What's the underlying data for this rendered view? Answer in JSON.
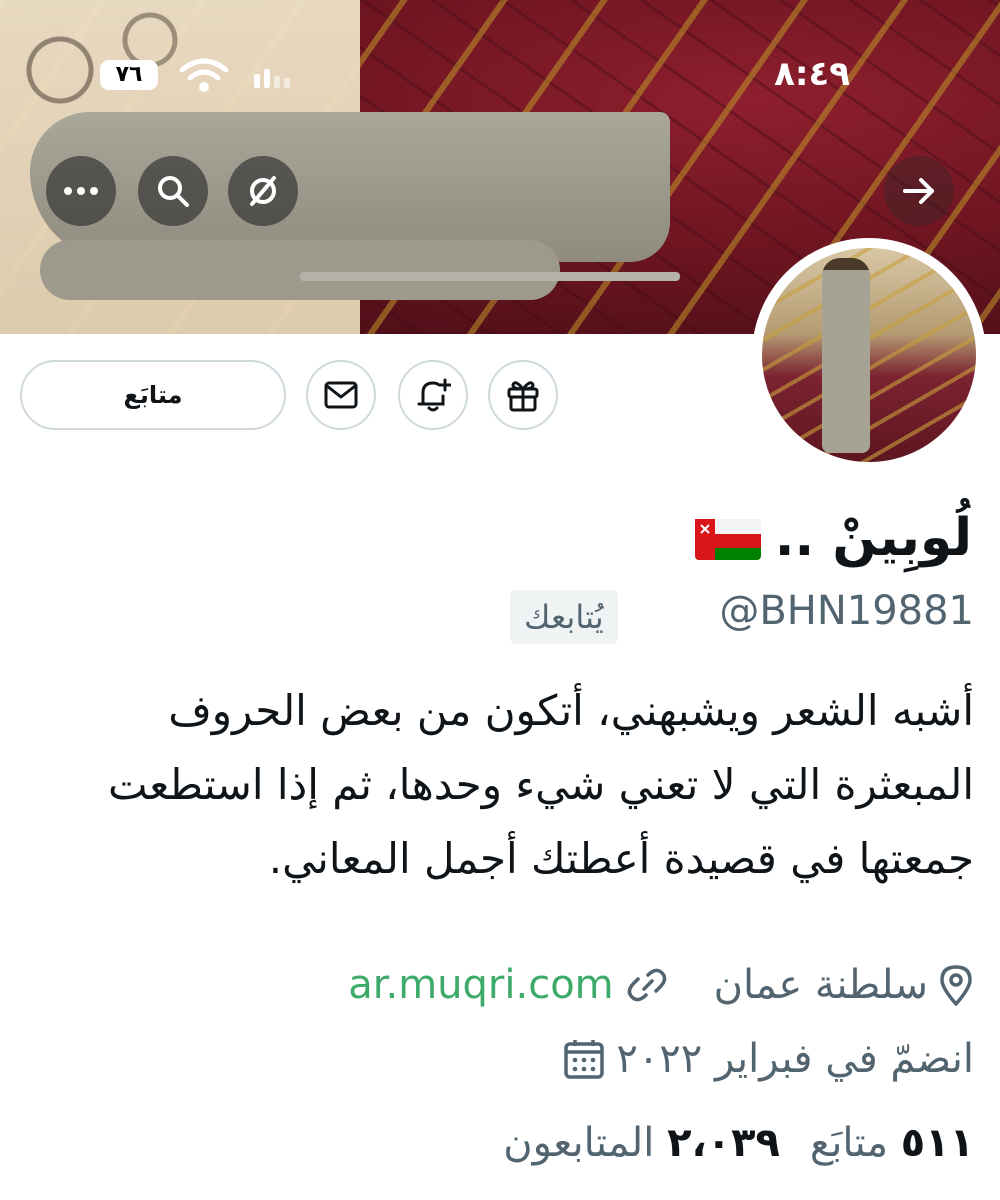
{
  "status_bar": {
    "time": "٨:٤٩",
    "battery": "٧٦"
  },
  "header": {
    "actions": [
      "more-icon",
      "search-icon",
      "grok-icon",
      "arrow-right-icon"
    ]
  },
  "profile": {
    "display_name": "لُوبِينْ ..",
    "flag": "oman-flag",
    "handle": "@BHN19881",
    "follows_you": "يُتابعك",
    "bio": "أشبه الشعر ويشبهني، أتكون من بعض الحروف المبعثرة التي لا تعني شيء وحدها، ثم إذا استطعت جمعتها في قصيدة أعطتك أجمل المعاني.",
    "location": "سلطنة عمان",
    "website": "ar.muqri.com",
    "joined": "انضمّ في فبراير ٢٠٢٢",
    "following_count": "٥١١",
    "following_label": "متابَع",
    "followers_count": "٢،٠٣٩",
    "followers_label": "المتابعون"
  },
  "actions": {
    "follow_label": "متابَع",
    "buttons": [
      "gift-icon",
      "notification-add-icon",
      "message-icon"
    ]
  },
  "colors": {
    "link": "#3daa6a",
    "secondary_text": "#536471",
    "border": "#cfd9de"
  }
}
